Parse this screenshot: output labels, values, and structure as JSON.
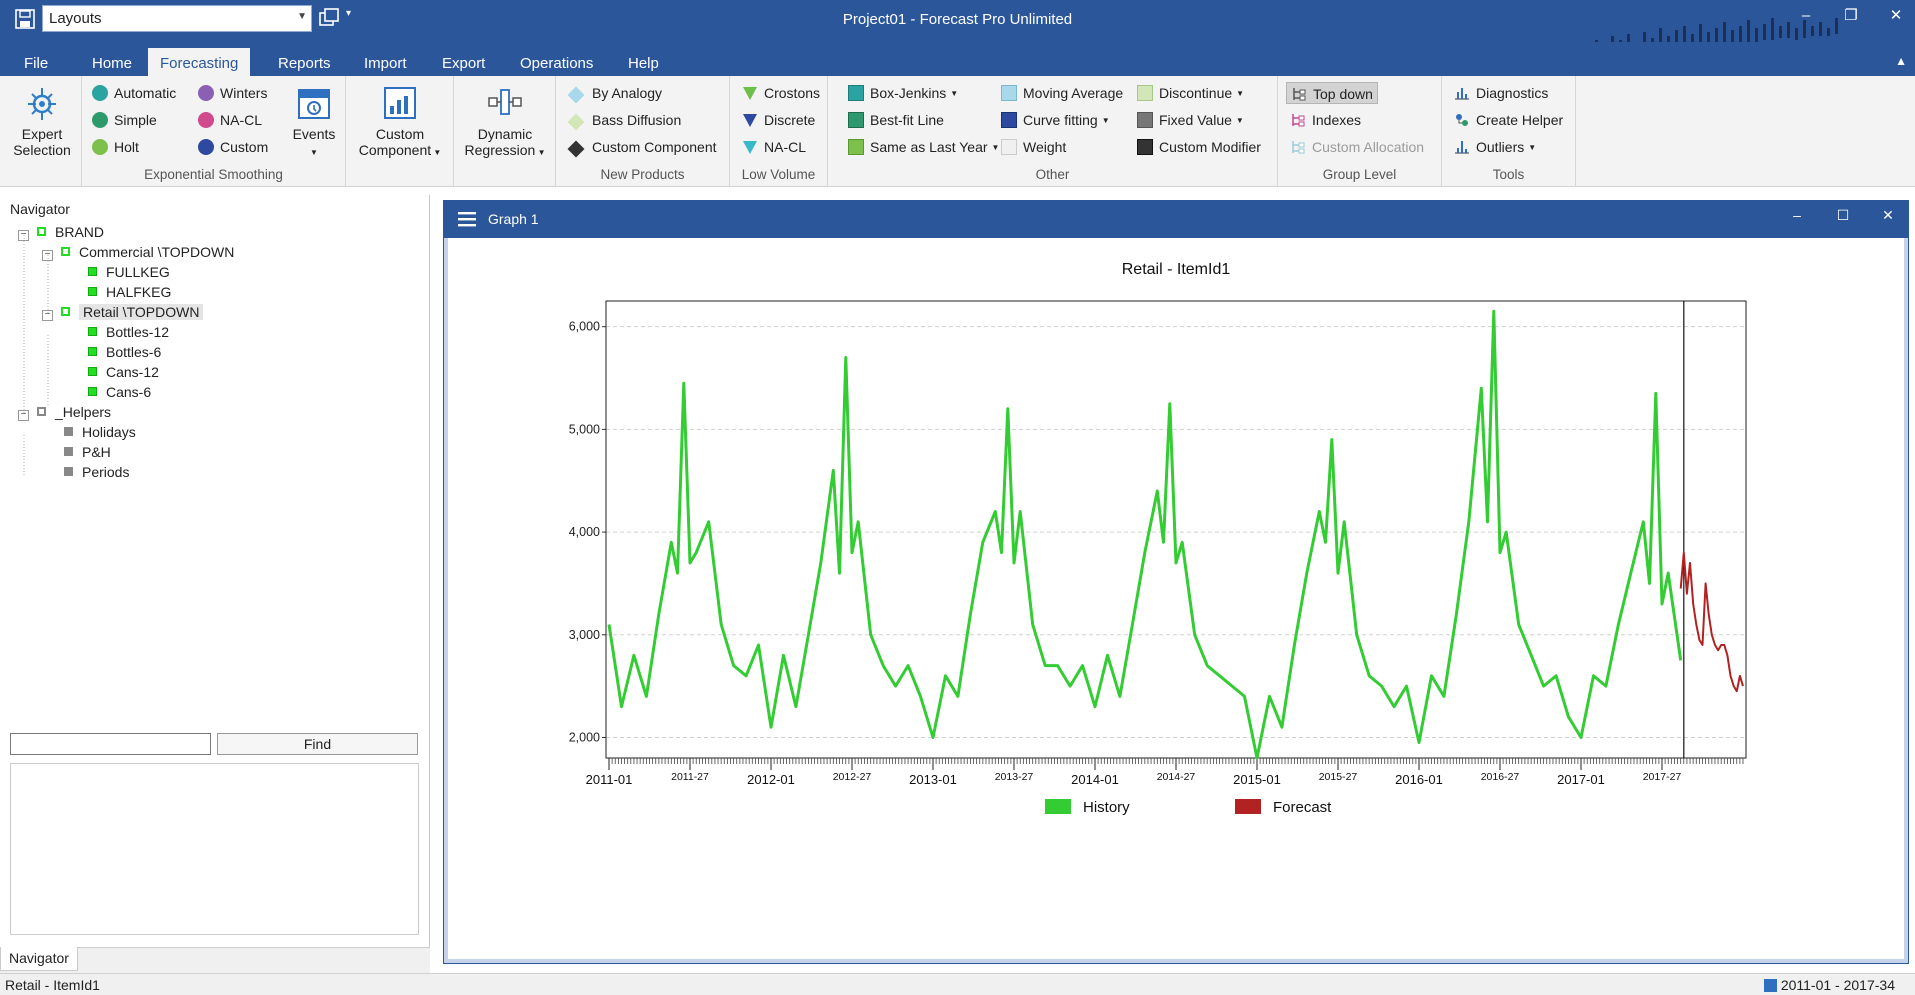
{
  "titlebar": {
    "layout_value": "Layouts",
    "app_title": "Project01 - Forecast Pro Unlimited"
  },
  "tabs": [
    "File",
    "Home",
    "Forecasting",
    "Reports",
    "Import",
    "Export",
    "Operations",
    "Help"
  ],
  "active_tab": "Forecasting",
  "ribbon": {
    "expert_selection": {
      "line1": "Expert",
      "line2": "Selection"
    },
    "exp_smoothing": {
      "label": "Exponential Smoothing",
      "automatic": "Automatic",
      "simple": "Simple",
      "holt": "Holt",
      "winters": "Winters",
      "nacl": "NA-CL",
      "custom": "Custom",
      "events": "Events"
    },
    "custom_component": {
      "line1": "Custom",
      "line2": "Component"
    },
    "dynamic_regression": {
      "line1": "Dynamic",
      "line2": "Regression"
    },
    "new_products": {
      "label": "New Products",
      "by_analogy": "By Analogy",
      "bass_diffusion": "Bass Diffusion",
      "custom_component": "Custom Component"
    },
    "low_volume": {
      "label": "Low Volume",
      "crostons": "Crostons",
      "discrete": "Discrete",
      "nacl": "NA-CL"
    },
    "other": {
      "label": "Other",
      "box_jenkins": "Box-Jenkins",
      "best_fit_line": "Best-fit Line",
      "same_as_last_year": "Same as Last Year",
      "moving_average": "Moving Average",
      "curve_fitting": "Curve fitting",
      "weight": "Weight",
      "discontinue": "Discontinue",
      "fixed_value": "Fixed Value",
      "custom_modifier": "Custom Modifier"
    },
    "group_level": {
      "label": "Group Level",
      "top_down": "Top down",
      "indexes": "Indexes",
      "custom_allocation": "Custom Allocation"
    },
    "tools": {
      "label": "Tools",
      "diagnostics": "Diagnostics",
      "create_helper": "Create Helper",
      "outliers": "Outliers"
    }
  },
  "navigator": {
    "title": "Navigator",
    "tree": {
      "brand": "BRAND",
      "commercial": "Commercial  \\TOPDOWN",
      "fullkeg": "FULLKEG",
      "halfkeg": "HALFKEG",
      "retail": "Retail  \\TOPDOWN",
      "bottles12": "Bottles-12",
      "bottles6": "Bottles-6",
      "cans12": "Cans-12",
      "cans6": "Cans-6",
      "helpers": "_Helpers",
      "holidays": "Holidays",
      "ph": "P&H",
      "periods": "Periods"
    },
    "find_value": "",
    "find_label": "Find",
    "bottom_tab": "Navigator"
  },
  "graph_window": {
    "title": "Graph 1"
  },
  "chart_data": {
    "type": "line",
    "title": "Retail - ItemId1",
    "xlabel": "",
    "ylabel": "",
    "ylim": [
      1800,
      6250
    ],
    "yticks": [
      "2,000",
      "3,000",
      "4,000",
      "5,000",
      "6,000"
    ],
    "xticks_major": [
      "2011-01",
      "2012-01",
      "2013-01",
      "2014-01",
      "2015-01",
      "2016-01",
      "2017-01"
    ],
    "xticks_minor": [
      "2011-27",
      "2012-27",
      "2013-27",
      "2014-27",
      "2015-27",
      "2016-27",
      "2017-27"
    ],
    "grid": "horizontal dashed",
    "legend_position": "bottom",
    "series": [
      {
        "name": "History",
        "color": "#33cc33",
        "x": [
          "2011-01",
          "2011-05",
          "2011-09",
          "2011-13",
          "2011-17",
          "2011-21",
          "2011-23",
          "2011-25",
          "2011-27",
          "2011-29",
          "2011-33",
          "2011-37",
          "2011-41",
          "2011-45",
          "2011-49",
          "2012-01",
          "2012-05",
          "2012-09",
          "2012-13",
          "2012-17",
          "2012-21",
          "2012-23",
          "2012-25",
          "2012-27",
          "2012-29",
          "2012-33",
          "2012-37",
          "2012-41",
          "2012-45",
          "2012-49",
          "2013-01",
          "2013-05",
          "2013-09",
          "2013-13",
          "2013-17",
          "2013-21",
          "2013-23",
          "2013-25",
          "2013-27",
          "2013-29",
          "2013-33",
          "2013-37",
          "2013-41",
          "2013-45",
          "2013-49",
          "2014-01",
          "2014-05",
          "2014-09",
          "2014-13",
          "2014-17",
          "2014-21",
          "2014-23",
          "2014-25",
          "2014-27",
          "2014-29",
          "2014-33",
          "2014-37",
          "2014-41",
          "2014-45",
          "2014-49",
          "2015-01",
          "2015-05",
          "2015-09",
          "2015-13",
          "2015-17",
          "2015-21",
          "2015-23",
          "2015-25",
          "2015-27",
          "2015-29",
          "2015-33",
          "2015-37",
          "2015-41",
          "2015-45",
          "2015-49",
          "2016-01",
          "2016-05",
          "2016-09",
          "2016-13",
          "2016-17",
          "2016-21",
          "2016-23",
          "2016-25",
          "2016-27",
          "2016-29",
          "2016-33",
          "2016-37",
          "2016-41",
          "2016-45",
          "2016-49",
          "2017-01",
          "2017-05",
          "2017-09",
          "2017-13",
          "2017-17",
          "2017-21",
          "2017-23",
          "2017-25",
          "2017-27",
          "2017-29",
          "2017-33"
        ],
        "values": [
          3100,
          2300,
          2800,
          2400,
          3200,
          3900,
          3600,
          5450,
          3700,
          3800,
          4100,
          3100,
          2700,
          2600,
          2900,
          2100,
          2800,
          2300,
          3000,
          3700,
          4600,
          3600,
          5700,
          3800,
          4100,
          3000,
          2700,
          2500,
          2700,
          2400,
          2000,
          2600,
          2400,
          3200,
          3900,
          4200,
          3800,
          5200,
          3700,
          4200,
          3100,
          2700,
          2700,
          2500,
          2700,
          2300,
          2800,
          2400,
          3100,
          3800,
          4400,
          3900,
          5250,
          3700,
          3900,
          3000,
          2700,
          2600,
          2500,
          2400,
          1800,
          2400,
          2100,
          2900,
          3600,
          4200,
          3900,
          4900,
          3600,
          4100,
          3000,
          2600,
          2500,
          2300,
          2500,
          1950,
          2600,
          2400,
          3200,
          4100,
          5400,
          4100,
          6150,
          3800,
          4000,
          3100,
          2800,
          2500,
          2600,
          2200,
          2000,
          2600,
          2500,
          3100,
          3600,
          4100,
          3500,
          5350,
          3300,
          3600,
          2750
        ]
      },
      {
        "name": "Forecast",
        "color": "#b22222",
        "x": [
          "2017-33",
          "2017-34",
          "2017-35",
          "2017-36",
          "2017-37",
          "2017-38",
          "2017-39",
          "2017-40",
          "2017-41",
          "2017-42",
          "2017-43",
          "2017-44",
          "2017-45",
          "2017-46",
          "2017-47",
          "2017-48",
          "2017-49",
          "2017-50",
          "2017-51",
          "2017-52",
          "2017-53"
        ],
        "values": [
          3450,
          3800,
          3400,
          3700,
          3300,
          3100,
          2950,
          2900,
          3500,
          3200,
          3000,
          2900,
          2850,
          2900,
          2900,
          2800,
          2600,
          2500,
          2450,
          2600,
          2500
        ]
      }
    ],
    "forecast_start_label": "2017-34"
  },
  "status": {
    "left": "Retail - ItemId1",
    "right": "2011-01 - 2017-34"
  }
}
